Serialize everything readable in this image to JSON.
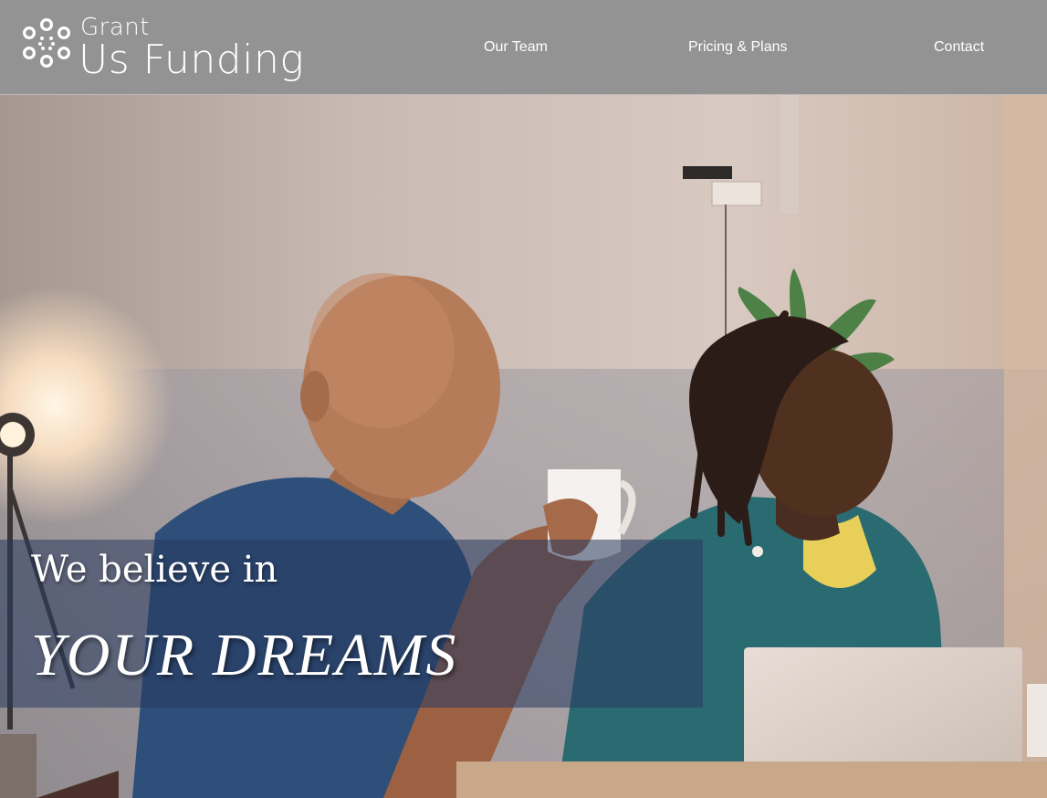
{
  "header": {
    "logo": {
      "line1": "Grant",
      "line2": "Us Funding",
      "icon": "dots-circle-logo-icon"
    },
    "nav": [
      {
        "label": "Our Team"
      },
      {
        "label": "Pricing & Plans"
      },
      {
        "label": "Contact"
      }
    ]
  },
  "hero": {
    "image": "hero-photo-two-people-smiling",
    "headline_line1": "We believe in",
    "headline_line2": "YOUR DREAMS"
  },
  "colors": {
    "header_bg": "#939393",
    "band_overlay": "#283a60",
    "text": "#ffffff"
  }
}
